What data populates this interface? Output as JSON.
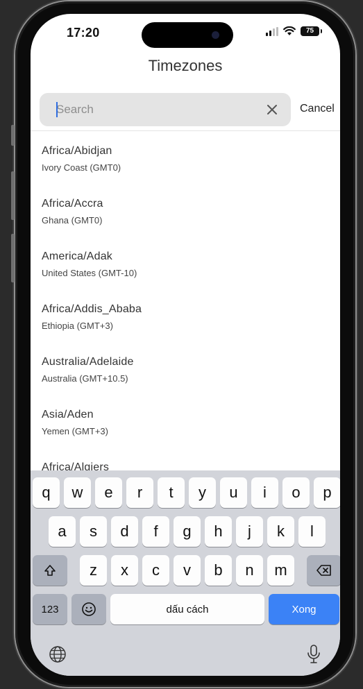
{
  "status_bar": {
    "time": "17:20",
    "battery": "75"
  },
  "header": {
    "title": "Timezones"
  },
  "search": {
    "placeholder": "Search",
    "value": "",
    "cancel_label": "Cancel"
  },
  "timezones": [
    {
      "name": "Africa/Abidjan",
      "detail": "Ivory Coast (GMT0)"
    },
    {
      "name": "Africa/Accra",
      "detail": "Ghana (GMT0)"
    },
    {
      "name": "America/Adak",
      "detail": "United States (GMT-10)"
    },
    {
      "name": "Africa/Addis_Ababa",
      "detail": "Ethiopia (GMT+3)"
    },
    {
      "name": "Australia/Adelaide",
      "detail": "Australia (GMT+10.5)"
    },
    {
      "name": "Asia/Aden",
      "detail": "Yemen (GMT+3)"
    },
    {
      "name": "Africa/Algiers",
      "detail": ""
    }
  ],
  "keyboard": {
    "row1": [
      "q",
      "w",
      "e",
      "r",
      "t",
      "y",
      "u",
      "i",
      "o",
      "p"
    ],
    "row2": [
      "a",
      "s",
      "d",
      "f",
      "g",
      "h",
      "j",
      "k",
      "l"
    ],
    "row3": [
      "z",
      "x",
      "c",
      "v",
      "b",
      "n",
      "m"
    ],
    "numbers_label": "123",
    "space_label": "dấu cách",
    "return_label": "Xong",
    "shift_icon": "shift-icon",
    "delete_icon": "delete-icon",
    "emoji_icon": "emoji-icon",
    "globe_icon": "globe-icon",
    "mic_icon": "microphone-icon"
  },
  "colors": {
    "accent": "#3b82f6",
    "keyboard_bg": "#d2d4da",
    "search_bg": "#e4e4e4"
  }
}
